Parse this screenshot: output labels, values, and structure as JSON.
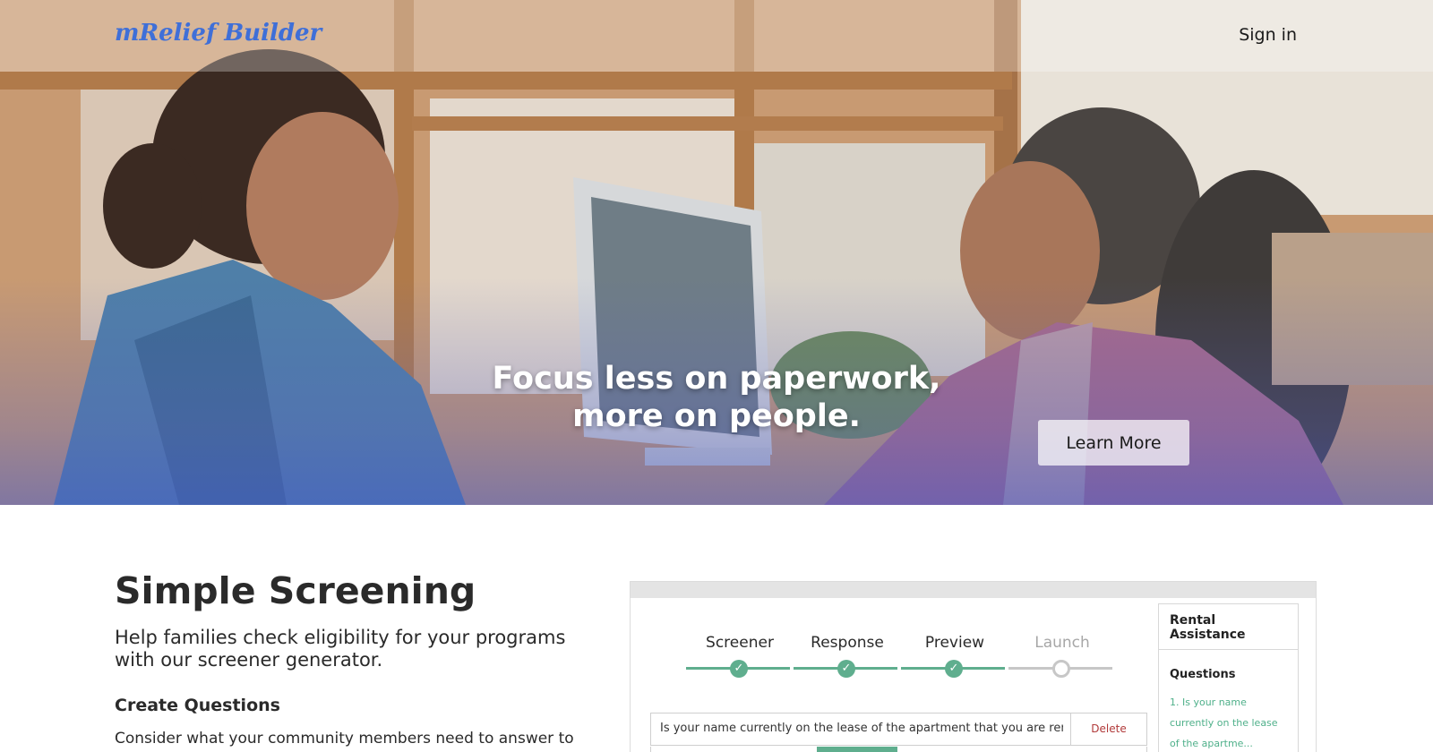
{
  "navbar": {
    "brand": "mRelief Builder",
    "sign_in": "Sign in"
  },
  "hero": {
    "headline_line1": "Focus less on paperwork,",
    "headline_line2": "more on people.",
    "cta_label": "Learn More",
    "overlay_color": "#4a5fd0"
  },
  "section": {
    "title": "Simple Screening",
    "subtitle": "Help families check eligibility for your programs with our screener generator.",
    "create_heading": "Create Questions",
    "create_text": "Consider what your community members need to answer to"
  },
  "app_preview": {
    "steps": [
      {
        "label": "Screener",
        "done": true
      },
      {
        "label": "Response",
        "done": true
      },
      {
        "label": "Preview",
        "done": true
      },
      {
        "label": "Launch",
        "done": false
      }
    ],
    "step_color": "#5fae8e",
    "question_text": "Is your name currently on the lease of the apartment that you are renting?",
    "delete_label": "Delete",
    "sidebar": {
      "title": "Rental Assistance",
      "questions_heading": "Questions",
      "items": [
        "1. Is your name",
        "currently on the lease",
        "of the apartme..."
      ]
    }
  }
}
